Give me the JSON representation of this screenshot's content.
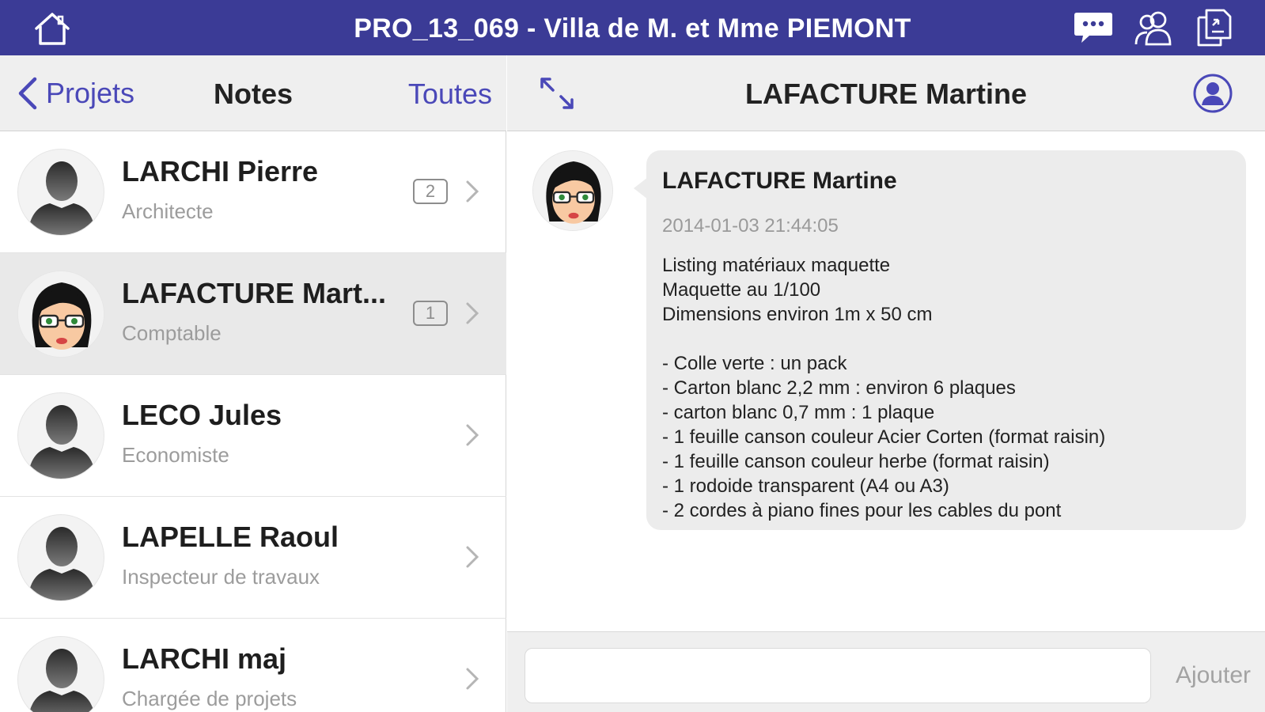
{
  "app": {
    "title": "PRO_13_069 - Villa de M. et Mme PIEMONT",
    "icons": [
      "home-icon",
      "chat-bubble-icon",
      "contacts-icon",
      "documents-icon"
    ],
    "brand_color": "#3b3b96",
    "accent_color": "#4a48b8"
  },
  "left_pane": {
    "back_label": "Projets",
    "title": "Notes",
    "filter_label": "Toutes",
    "contacts": [
      {
        "name": "LARCHI Pierre",
        "role": "Architecte",
        "badge": "2",
        "avatar": "silhouette",
        "selected": false
      },
      {
        "name": "LAFACTURE Mart...",
        "role": "Comptable",
        "badge": "1",
        "avatar": "cartoon-woman",
        "selected": true
      },
      {
        "name": "LECO Jules",
        "role": "Economiste",
        "badge": "",
        "avatar": "silhouette",
        "selected": false
      },
      {
        "name": "LAPELLE Raoul",
        "role": "Inspecteur de travaux",
        "badge": "",
        "avatar": "silhouette",
        "selected": false
      },
      {
        "name": "LARCHI maj",
        "role": "Chargée de projets",
        "badge": "",
        "avatar": "silhouette",
        "selected": false
      }
    ]
  },
  "right_pane": {
    "title": "LAFACTURE Martine",
    "message": {
      "author": "LAFACTURE Martine",
      "timestamp": "2014-01-03 21:44:05",
      "body": "Listing matériaux maquette\nMaquette au 1/100\nDimensions environ 1m x 50 cm\n\n- Colle verte : un pack\n- Carton blanc 2,2 mm : environ 6 plaques\n- carton blanc 0,7 mm : 1 plaque\n- 1 feuille canson couleur Acier Corten (format raisin)\n- 1 feuille canson couleur herbe (format raisin)\n- 1 rodoide transparent (A4 ou A3)\n- 2 cordes à piano fines pour les cables du pont"
    },
    "composer": {
      "placeholder": "",
      "add_label": "Ajouter"
    }
  }
}
